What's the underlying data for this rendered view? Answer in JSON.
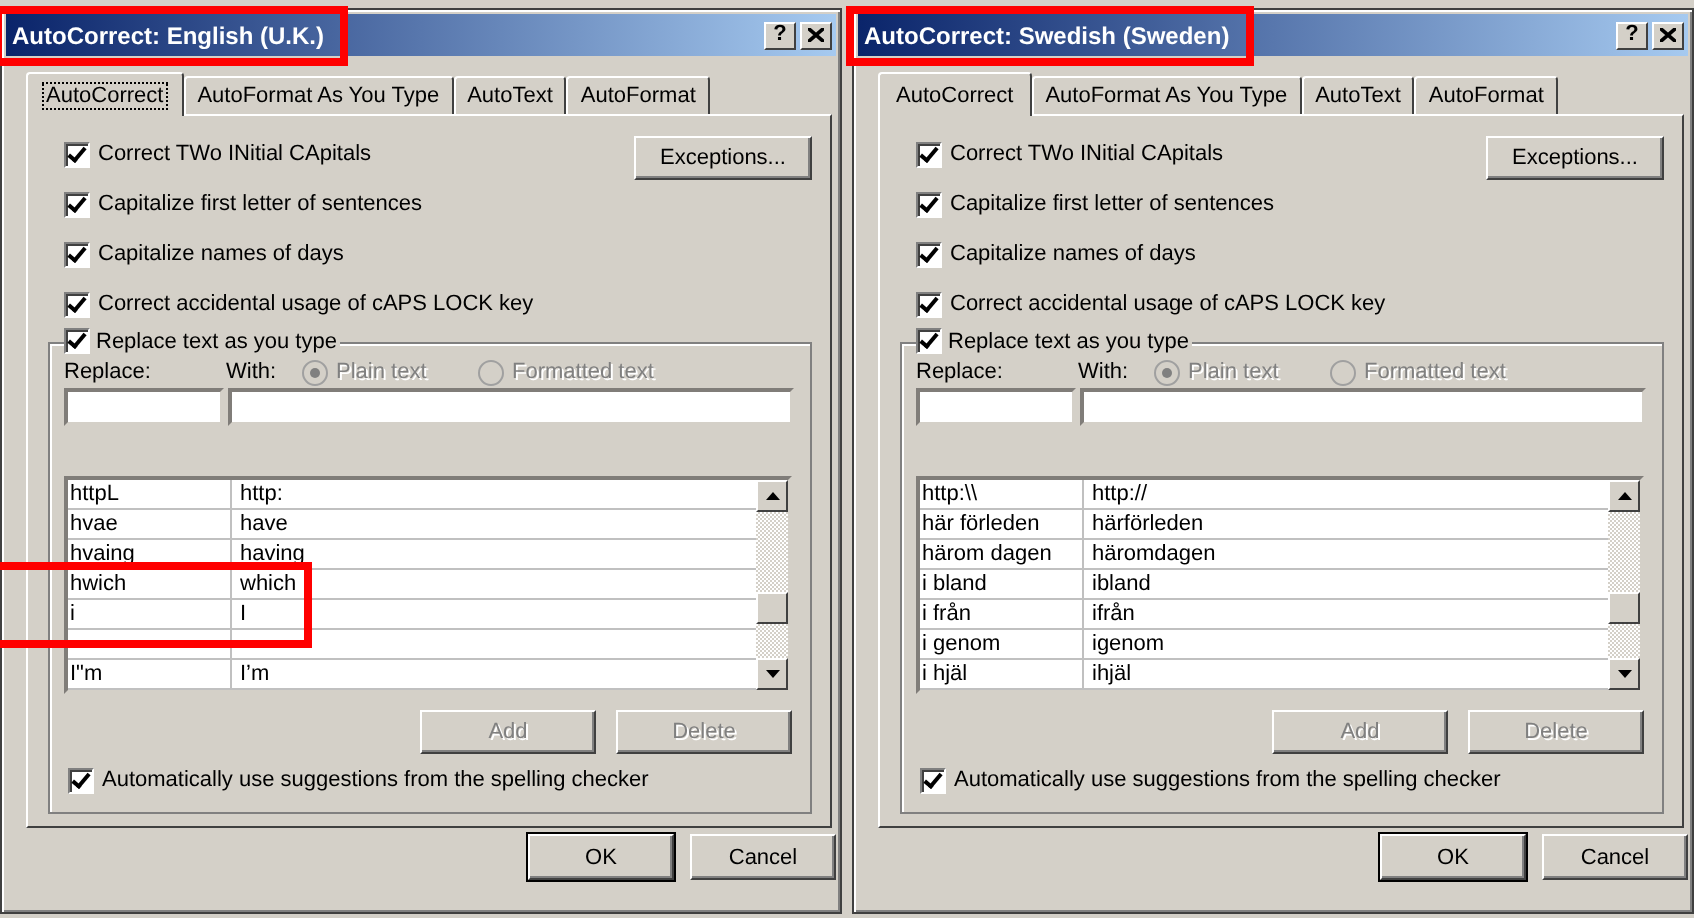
{
  "dialogs": [
    {
      "title": "AutoCorrect: English (U.K.)",
      "title_highlighted": true,
      "help_button": "?",
      "tabs": [
        {
          "label": "AutoCorrect",
          "selected": true,
          "focused": true
        },
        {
          "label": "AutoFormat As You Type",
          "selected": false,
          "focused": false
        },
        {
          "label": "AutoText",
          "selected": false,
          "focused": false
        },
        {
          "label": "AutoFormat",
          "selected": false,
          "focused": false
        }
      ],
      "options": [
        {
          "label": "Correct TWo INitial CApitals",
          "checked": true
        },
        {
          "label": "Capitalize first letter of sentences",
          "checked": true
        },
        {
          "label": "Capitalize names of days",
          "checked": true
        },
        {
          "label": "Correct accidental usage of cAPS LOCK key",
          "checked": true
        }
      ],
      "exceptions_button": "Exceptions...",
      "replace_group": {
        "label": "Replace text as you type",
        "checked": true
      },
      "replace_label": "Replace:",
      "with_label": "With:",
      "radios": [
        {
          "label": "Plain text",
          "selected": true,
          "disabled": true
        },
        {
          "label": "Formatted text",
          "selected": false,
          "disabled": true
        }
      ],
      "entries": [
        {
          "kind": "text",
          "replace": "httpL",
          "with": "http:",
          "highlighted": false
        },
        {
          "kind": "text",
          "replace": "hvae",
          "with": "have",
          "highlighted": false
        },
        {
          "kind": "text",
          "replace": "hvaing",
          "with": "having",
          "highlighted": false
        },
        {
          "kind": "text",
          "replace": "hwich",
          "with": "which",
          "highlighted": true
        },
        {
          "kind": "text",
          "replace": "i",
          "with": "I",
          "highlighted": true
        },
        {
          "kind": "obscured",
          "highlighted": false
        },
        {
          "kind": "text",
          "replace": "I\"m",
          "with": "I’m",
          "highlighted": false
        }
      ],
      "add_button": {
        "label": "Add",
        "disabled": true
      },
      "delete_button": {
        "label": "Delete",
        "disabled": true
      },
      "suggestions": {
        "label": "Automatically use suggestions from the spelling checker",
        "checked": true
      },
      "ok_button": "OK",
      "cancel_button": "Cancel"
    },
    {
      "title": "AutoCorrect: Swedish (Sweden)",
      "title_highlighted": true,
      "help_button": "?",
      "tabs": [
        {
          "label": "AutoCorrect",
          "selected": true,
          "focused": false
        },
        {
          "label": "AutoFormat As You Type",
          "selected": false,
          "focused": false
        },
        {
          "label": "AutoText",
          "selected": false,
          "focused": false
        },
        {
          "label": "AutoFormat",
          "selected": false,
          "focused": false
        }
      ],
      "options": [
        {
          "label": "Correct TWo INitial CApitals",
          "checked": true
        },
        {
          "label": "Capitalize first letter of sentences",
          "checked": true
        },
        {
          "label": "Capitalize names of days",
          "checked": true
        },
        {
          "label": "Correct accidental usage of cAPS LOCK key",
          "checked": true
        }
      ],
      "exceptions_button": "Exceptions...",
      "replace_group": {
        "label": "Replace text as you type",
        "checked": true
      },
      "replace_label": "Replace:",
      "with_label": "With:",
      "radios": [
        {
          "label": "Plain text",
          "selected": true,
          "disabled": true
        },
        {
          "label": "Formatted text",
          "selected": false,
          "disabled": true
        }
      ],
      "entries": [
        {
          "kind": "text",
          "replace": "http:\\\\",
          "with": "http://",
          "highlighted": false
        },
        {
          "kind": "text",
          "replace": "här förleden",
          "with": "härförleden",
          "highlighted": false
        },
        {
          "kind": "text",
          "replace": "härom dagen",
          "with": "häromdagen",
          "highlighted": false
        },
        {
          "kind": "text",
          "replace": "i bland",
          "with": "ibland",
          "highlighted": false
        },
        {
          "kind": "text",
          "replace": "i från",
          "with": "ifrån",
          "highlighted": false
        },
        {
          "kind": "text",
          "replace": "i genom",
          "with": "igenom",
          "highlighted": false
        },
        {
          "kind": "text",
          "replace": "i hjäl",
          "with": "ihjäl",
          "highlighted": false
        }
      ],
      "add_button": {
        "label": "Add",
        "disabled": true
      },
      "delete_button": {
        "label": "Delete",
        "disabled": true
      },
      "suggestions": {
        "label": "Automatically use suggestions from the spelling checker",
        "checked": true
      },
      "ok_button": "OK",
      "cancel_button": "Cancel"
    }
  ]
}
